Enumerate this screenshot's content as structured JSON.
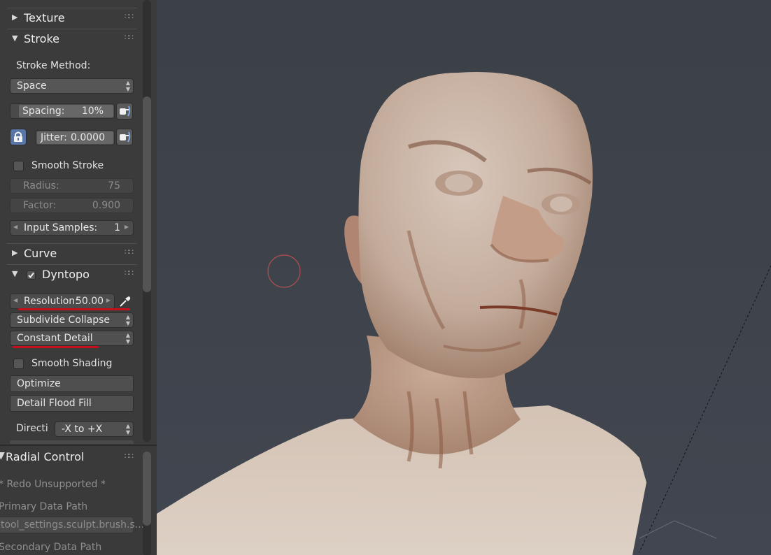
{
  "panels": {
    "texture": {
      "title": "Texture"
    },
    "stroke": {
      "title": "Stroke",
      "method_label": "Stroke Method:",
      "method_value": "Space",
      "spacing_label": "Spacing:",
      "spacing_value": "10%",
      "jitter_label": "Jitter:",
      "jitter_value": "0.0000",
      "smooth_stroke_label": "Smooth Stroke",
      "radius_label": "Radius:",
      "radius_value": "75",
      "factor_label": "Factor:",
      "factor_value": "0.900",
      "input_samples_label": "Input Samples:",
      "input_samples_value": "1"
    },
    "curve": {
      "title": "Curve"
    },
    "dyntopo": {
      "title": "Dyntopo",
      "resolution_label": "Resolution:",
      "resolution_value": "50.00",
      "subdivide_mode": "Subdivide Collapse",
      "detail_mode": "Constant Detail",
      "smooth_shading_label": "Smooth Shading",
      "optimize_label": "Optimize",
      "flood_fill_label": "Detail Flood Fill",
      "direction_label": "Directi",
      "direction_value": "-X to +X"
    }
  },
  "redo_panel": {
    "title": "Radial Control",
    "notice": "* Redo Unsupported *",
    "primary_label": "Primary Data Path",
    "primary_value": "tool_settings.sculpt.brush.s...",
    "secondary_label": "Secondary Data Path"
  },
  "colors": {
    "annotation_red": "#c8101a",
    "viewport_bg": "#3d4148",
    "brush_circle": "#b05050"
  },
  "icons": [
    "disclosure-triangle-icon",
    "grip-icon",
    "eyedropper-icon",
    "lock-icon",
    "pressure-hand-icon",
    "checkmark-icon"
  ]
}
